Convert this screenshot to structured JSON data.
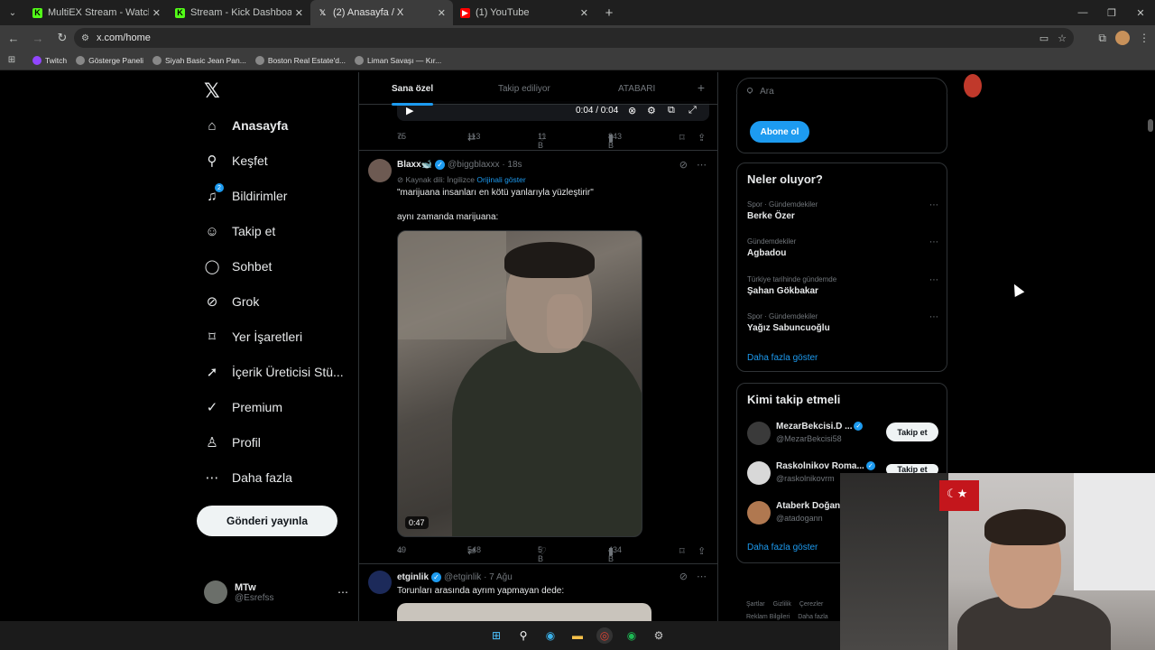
{
  "browser": {
    "tabs": [
      {
        "title": "MultiEX Stream - Watch Live on",
        "favicon_color": "#53fc18",
        "active": false
      },
      {
        "title": "Stream - Kick Dashboard",
        "favicon_color": "#53fc18",
        "active": false
      },
      {
        "title": "(2) Anasayfa / X",
        "favicon_color": "#000000",
        "active": true
      },
      {
        "title": "(1) YouTube",
        "favicon_color": "#ff0000",
        "active": false
      }
    ],
    "url": "x.com/home",
    "bookmarks": [
      "Twitch",
      "Gösterge Paneli",
      "Siyah Basic Jean Pan...",
      "Boston Real Estate'd...",
      "Liman Savaşı — Kır..."
    ]
  },
  "nav": {
    "items": [
      {
        "label": "Anasayfa",
        "icon": "home-icon",
        "glyph": "⌂",
        "bold": true
      },
      {
        "label": "Keşfet",
        "icon": "search-icon",
        "glyph": "⚲",
        "bold": false
      },
      {
        "label": "Bildirimler",
        "icon": "bell-icon",
        "glyph": "🔔︎",
        "bold": false,
        "badge": "2"
      },
      {
        "label": "Takip et",
        "icon": "add-user-icon",
        "glyph": "☺",
        "bold": false
      },
      {
        "label": "Sohbet",
        "icon": "chat-icon",
        "glyph": "◯",
        "bold": false
      },
      {
        "label": "Grok",
        "icon": "grok-icon",
        "glyph": "⊘",
        "bold": false
      },
      {
        "label": "Yer İşaretleri",
        "icon": "bookmark-icon",
        "glyph": "⌑",
        "bold": false
      },
      {
        "label": "İçerik Üreticisi Stü...",
        "icon": "rocket-icon",
        "glyph": "➚",
        "bold": false
      },
      {
        "label": "Premium",
        "icon": "premium-icon",
        "glyph": "✓",
        "bold": false
      },
      {
        "label": "Profil",
        "icon": "profile-icon",
        "glyph": "♙",
        "bold": false
      },
      {
        "label": "Daha fazla",
        "icon": "more-icon",
        "glyph": "⋯",
        "bold": false
      }
    ],
    "post_button": "Gönderi yayınla",
    "account": {
      "name": "MTw",
      "handle": "@Esrefss"
    }
  },
  "timeline": {
    "tabs": [
      "Sana özel",
      "Takip ediliyor",
      "ATABARI"
    ],
    "video_time": "0:04 / 0:04",
    "first_actions": {
      "replies": "75",
      "reposts": "113",
      "likes": "11 B",
      "views": "843 B"
    },
    "tweet1": {
      "name": "Blaxx🐋",
      "handle": "@biggblaxxx · 18s",
      "source_lang": "Kaynak dili: İngilizce",
      "show_original": "Orijinali göster",
      "line1": "\"marijuana insanları en kötü yanlarıyla yüzleştirir\"",
      "line2": "aynı zamanda marijuana:",
      "video_duration": "0:47",
      "actions": {
        "replies": "49",
        "reposts": "548",
        "likes": "5 B",
        "views": "434 B"
      }
    },
    "tweet2": {
      "name": "etginlik",
      "handle": "@etginlik · 7 Ağu",
      "text": "Torunları arasında ayrım yapmayan dede:"
    }
  },
  "right": {
    "search_placeholder": "Ara",
    "subscribe_button": "Abone ol",
    "trends_title": "Neler oluyor?",
    "trends": [
      {
        "context": "Spor · Gündemdekiler",
        "name": "Berke Özer"
      },
      {
        "context": "Gündemdekiler",
        "name": "Agbadou"
      },
      {
        "context": "Türkiye tarihinde gündemde",
        "name": "Şahan Gökbakar"
      },
      {
        "context": "Spor · Gündemdekiler",
        "name": "Yağız Sabuncuoğlu"
      }
    ],
    "trends_more": "Daha fazla göster",
    "who_title": "Kimi takip etmeli",
    "who": [
      {
        "name": "MezarBekcisi.D ...",
        "handle": "@MezarBekcisi58",
        "button": "Takip et",
        "verified": true
      },
      {
        "name": "Raskolnikov Roma...",
        "handle": "@raskolnikovrm",
        "button": "Takip et",
        "verified": true
      },
      {
        "name": "Ataberk Doğan",
        "handle": "@atadogann",
        "button": "",
        "verified": false
      }
    ],
    "who_more": "Daha fazla göster",
    "footer": [
      "Şartlar",
      "Gizlilik",
      "Çerezler",
      "Reklam Bilgileri",
      "Daha fazla"
    ]
  }
}
